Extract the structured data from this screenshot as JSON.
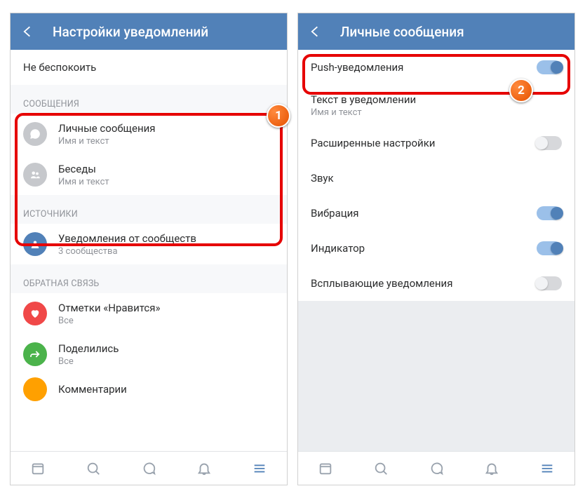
{
  "left": {
    "header_title": "Настройки уведомлений",
    "do_not_disturb": "Не беспокоить",
    "section_messages": "СООБЩЕНИЯ",
    "private_messages": {
      "label": "Личные сообщения",
      "sub": "Имя и текст"
    },
    "chats": {
      "label": "Беседы",
      "sub": "Имя и текст"
    },
    "section_sources": "ИСТОЧНИКИ",
    "community_notifications": {
      "label": "Уведомления от сообществ",
      "sub": "3 сообщества"
    },
    "section_feedback": "ОБРАТНАЯ СВЯЗЬ",
    "likes": {
      "label": "Отметки «Нравится»",
      "sub": "Все"
    },
    "shares": {
      "label": "Поделились",
      "sub": "Все"
    },
    "comments": {
      "label": "Комментарии"
    }
  },
  "right": {
    "header_title": "Личные сообщения",
    "push": "Push-уведомления",
    "text_in_notification": {
      "label": "Текст в уведомлении",
      "sub": "Имя и текст"
    },
    "advanced_settings": "Расширенные настройки",
    "sound": "Звук",
    "vibration": "Вибрация",
    "indicator": "Индикатор",
    "popup": "Всплывающие уведомления"
  },
  "badges": {
    "one": "1",
    "two": "2"
  }
}
